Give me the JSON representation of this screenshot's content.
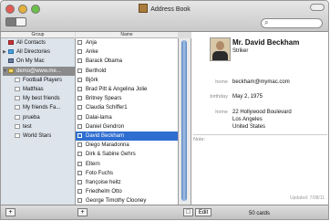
{
  "window": {
    "title": "Address Book"
  },
  "columns": {
    "group": "Group",
    "name": "Name"
  },
  "groups": [
    {
      "label": "All Contacts",
      "icon": "address-book-icon",
      "type": "g1",
      "indent": 0
    },
    {
      "label": "All Directories",
      "icon": "globe-icon",
      "type": "g2",
      "indent": 0,
      "tri": "▶"
    },
    {
      "label": "On My Mac",
      "icon": "computer-icon",
      "type": "g3",
      "indent": 0
    },
    {
      "label": "demo@www.me...",
      "icon": "account-icon",
      "type": "g4",
      "indent": 0,
      "tri": "▼",
      "selected": true
    },
    {
      "label": "Football Players",
      "icon": "group-icon",
      "type": "g5",
      "indent": 1
    },
    {
      "label": "Matthias",
      "icon": "group-icon",
      "type": "g5",
      "indent": 1
    },
    {
      "label": "My best friends",
      "icon": "group-icon",
      "type": "g5",
      "indent": 1
    },
    {
      "label": "My friends Fa...",
      "icon": "group-icon",
      "type": "g5",
      "indent": 1
    },
    {
      "label": "prueba",
      "icon": "group-icon",
      "type": "g5",
      "indent": 1
    },
    {
      "label": "test",
      "icon": "group-icon",
      "type": "g5",
      "indent": 1
    },
    {
      "label": "World Stars",
      "icon": "group-icon",
      "type": "g5",
      "indent": 1
    }
  ],
  "names": [
    "Anja",
    "Anke",
    "Barack Obama",
    "Berthold",
    "Björk",
    "Brad Pitt & Angelina Jolie",
    "Britney Spears",
    "Claudia Schiffer1",
    "Dalai-lama",
    "Daniel Gendron",
    "David Beckham",
    "Diego Maradonna",
    "Dirk & Sabine Gehrs",
    "Eltern",
    "Foto Fuchs",
    "françoise heitz",
    "Friedhelm Otto",
    "George Timothy Clooney"
  ],
  "selected_name_index": 10,
  "card": {
    "name": "Mr. David Beckham",
    "job": "Striker",
    "fields": [
      {
        "label": "home",
        "value": "beckham@mymac.com"
      },
      {
        "label": "birthday",
        "value": "May 2, 1975"
      },
      {
        "label": "home",
        "value": "22 Hollywood Boulevard"
      },
      {
        "label": "",
        "value": "Los Angeles"
      },
      {
        "label": "",
        "value": "United States"
      }
    ],
    "note_label": "Note:",
    "updated": "Updated: 7/08/11"
  },
  "bottom": {
    "add_group": "+",
    "add_contact": "+",
    "edit": "Edit",
    "count": "50 cards",
    "view_toggle": "□"
  },
  "search": {
    "icon": "magnifier-icon",
    "glyph": "⌕"
  }
}
